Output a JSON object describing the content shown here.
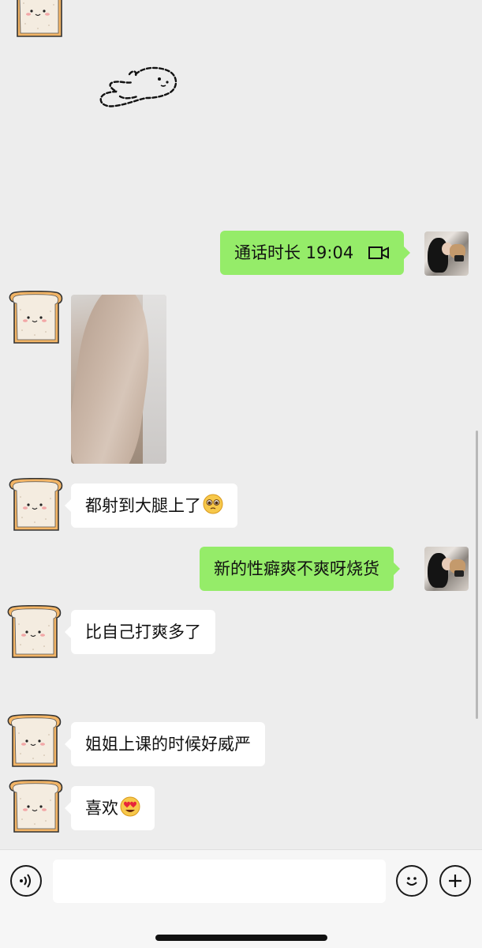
{
  "messages": {
    "call": {
      "text": "通话时长 19:04"
    },
    "m1": {
      "text": "都射到大腿上了"
    },
    "m2": {
      "text": "新的性癖爽不爽呀烧货"
    },
    "m3": {
      "text": "比自己打爽多了"
    },
    "m4": {
      "text": "姐姐上课的时候好威严"
    },
    "m5": {
      "text": "喜欢"
    }
  },
  "icons": {
    "incoming_avatar": "toast-bread-avatar",
    "outgoing_avatar": "user-photo-avatar",
    "sticker": "doodle-dog-sticker",
    "call": "video-call-icon",
    "emoji_pleading": "pleading-face-emoji",
    "emoji_heart_eyes": "heart-eyes-emoji",
    "voice": "voice-icon",
    "emoji_button": "smiley-icon",
    "more": "plus-icon"
  },
  "colors": {
    "background": "#ededed",
    "incoming_bubble": "#ffffff",
    "outgoing_bubble": "#95ec69"
  },
  "input": {
    "value": "",
    "placeholder": ""
  }
}
